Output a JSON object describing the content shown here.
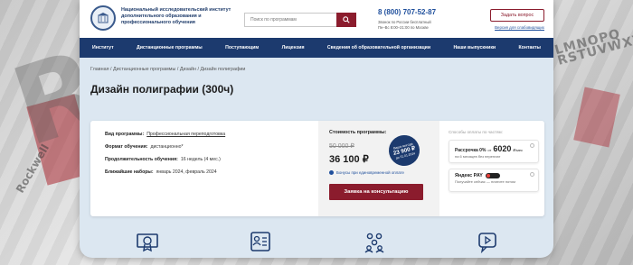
{
  "header": {
    "logo_text": "Национальный исследовательский институт дополнительного образования и профессионального обучения",
    "search_placeholder": "Поиск по программам",
    "phone": "8 (800) 707-52-87",
    "phone_sub_1": "Звонок по России бесплатный",
    "phone_sub_2": "Пн–Вс 8:00–21:00 по Москве",
    "ask_button": "Задать вопрос",
    "accessibility_link": "Версия для слабовидящих"
  },
  "nav": {
    "items": [
      "Институт",
      "Дистанционные программы",
      "Поступающим",
      "Лицензия",
      "Сведения об образовательной организации",
      "Наши выпускники",
      "Контакты"
    ]
  },
  "breadcrumb": {
    "text": "Главная / Дистанционные программы / Дизайн / Дизайн полиграфии"
  },
  "page": {
    "title": "Дизайн полиграфии (300ч)"
  },
  "program": {
    "type_label": "Вид программы:",
    "type_value": "Профессиональная переподготовка",
    "format_label": "Формат обучения:",
    "format_value": "дистанционно*",
    "duration_label": "Продолжительность обучения:",
    "duration_value": "16 недель (4 мес.)",
    "next_label": "Ближайшие наборы:",
    "next_value": "январь 2024, февраль 2024"
  },
  "pricing": {
    "label": "Стоимость программы:",
    "old_price": "50 000 ₽",
    "new_price": "36 100 ₽",
    "bonus_text": "Бонусы при единовременной оплате",
    "badge_line1": "Ваша выгода",
    "badge_line2": "23 900 ₽",
    "badge_line3": "до 31.01.2024",
    "consult_button": "Заявка на консультацию"
  },
  "installment": {
    "title": "Способы оплаты по частям:",
    "plan_prefix": "Рассрочка 0%",
    "plan_from": "от",
    "plan_amount": "6020",
    "plan_unit": "₽/мес",
    "plan_sub": "на 6 месяцев без переплат",
    "yandex_label": "Яндекс PAY",
    "yandex_sub": "Получайте сейчас — платите потом"
  },
  "feature_icons": [
    "certificate-icon",
    "id-card-icon",
    "group-icon",
    "video-chat-icon"
  ],
  "colors": {
    "brand_blue": "#1c3a6e",
    "brand_red": "#8b1c2d",
    "page_bg": "#dce7f1"
  }
}
